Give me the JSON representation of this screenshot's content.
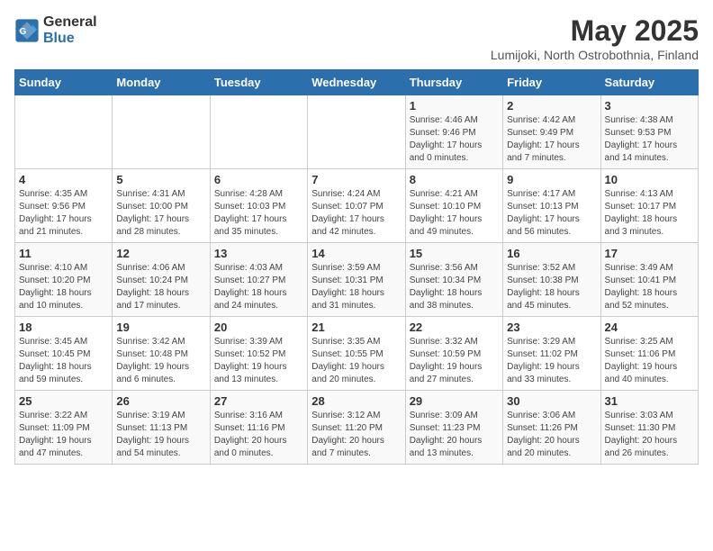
{
  "header": {
    "logo_general": "General",
    "logo_blue": "Blue",
    "title": "May 2025",
    "subtitle": "Lumijoki, North Ostrobothnia, Finland"
  },
  "weekdays": [
    "Sunday",
    "Monday",
    "Tuesday",
    "Wednesday",
    "Thursday",
    "Friday",
    "Saturday"
  ],
  "weeks": [
    [
      {
        "day": "",
        "info": ""
      },
      {
        "day": "",
        "info": ""
      },
      {
        "day": "",
        "info": ""
      },
      {
        "day": "",
        "info": ""
      },
      {
        "day": "1",
        "info": "Sunrise: 4:46 AM\nSunset: 9:46 PM\nDaylight: 17 hours\nand 0 minutes."
      },
      {
        "day": "2",
        "info": "Sunrise: 4:42 AM\nSunset: 9:49 PM\nDaylight: 17 hours\nand 7 minutes."
      },
      {
        "day": "3",
        "info": "Sunrise: 4:38 AM\nSunset: 9:53 PM\nDaylight: 17 hours\nand 14 minutes."
      }
    ],
    [
      {
        "day": "4",
        "info": "Sunrise: 4:35 AM\nSunset: 9:56 PM\nDaylight: 17 hours\nand 21 minutes."
      },
      {
        "day": "5",
        "info": "Sunrise: 4:31 AM\nSunset: 10:00 PM\nDaylight: 17 hours\nand 28 minutes."
      },
      {
        "day": "6",
        "info": "Sunrise: 4:28 AM\nSunset: 10:03 PM\nDaylight: 17 hours\nand 35 minutes."
      },
      {
        "day": "7",
        "info": "Sunrise: 4:24 AM\nSunset: 10:07 PM\nDaylight: 17 hours\nand 42 minutes."
      },
      {
        "day": "8",
        "info": "Sunrise: 4:21 AM\nSunset: 10:10 PM\nDaylight: 17 hours\nand 49 minutes."
      },
      {
        "day": "9",
        "info": "Sunrise: 4:17 AM\nSunset: 10:13 PM\nDaylight: 17 hours\nand 56 minutes."
      },
      {
        "day": "10",
        "info": "Sunrise: 4:13 AM\nSunset: 10:17 PM\nDaylight: 18 hours\nand 3 minutes."
      }
    ],
    [
      {
        "day": "11",
        "info": "Sunrise: 4:10 AM\nSunset: 10:20 PM\nDaylight: 18 hours\nand 10 minutes."
      },
      {
        "day": "12",
        "info": "Sunrise: 4:06 AM\nSunset: 10:24 PM\nDaylight: 18 hours\nand 17 minutes."
      },
      {
        "day": "13",
        "info": "Sunrise: 4:03 AM\nSunset: 10:27 PM\nDaylight: 18 hours\nand 24 minutes."
      },
      {
        "day": "14",
        "info": "Sunrise: 3:59 AM\nSunset: 10:31 PM\nDaylight: 18 hours\nand 31 minutes."
      },
      {
        "day": "15",
        "info": "Sunrise: 3:56 AM\nSunset: 10:34 PM\nDaylight: 18 hours\nand 38 minutes."
      },
      {
        "day": "16",
        "info": "Sunrise: 3:52 AM\nSunset: 10:38 PM\nDaylight: 18 hours\nand 45 minutes."
      },
      {
        "day": "17",
        "info": "Sunrise: 3:49 AM\nSunset: 10:41 PM\nDaylight: 18 hours\nand 52 minutes."
      }
    ],
    [
      {
        "day": "18",
        "info": "Sunrise: 3:45 AM\nSunset: 10:45 PM\nDaylight: 18 hours\nand 59 minutes."
      },
      {
        "day": "19",
        "info": "Sunrise: 3:42 AM\nSunset: 10:48 PM\nDaylight: 19 hours\nand 6 minutes."
      },
      {
        "day": "20",
        "info": "Sunrise: 3:39 AM\nSunset: 10:52 PM\nDaylight: 19 hours\nand 13 minutes."
      },
      {
        "day": "21",
        "info": "Sunrise: 3:35 AM\nSunset: 10:55 PM\nDaylight: 19 hours\nand 20 minutes."
      },
      {
        "day": "22",
        "info": "Sunrise: 3:32 AM\nSunset: 10:59 PM\nDaylight: 19 hours\nand 27 minutes."
      },
      {
        "day": "23",
        "info": "Sunrise: 3:29 AM\nSunset: 11:02 PM\nDaylight: 19 hours\nand 33 minutes."
      },
      {
        "day": "24",
        "info": "Sunrise: 3:25 AM\nSunset: 11:06 PM\nDaylight: 19 hours\nand 40 minutes."
      }
    ],
    [
      {
        "day": "25",
        "info": "Sunrise: 3:22 AM\nSunset: 11:09 PM\nDaylight: 19 hours\nand 47 minutes."
      },
      {
        "day": "26",
        "info": "Sunrise: 3:19 AM\nSunset: 11:13 PM\nDaylight: 19 hours\nand 54 minutes."
      },
      {
        "day": "27",
        "info": "Sunrise: 3:16 AM\nSunset: 11:16 PM\nDaylight: 20 hours\nand 0 minutes."
      },
      {
        "day": "28",
        "info": "Sunrise: 3:12 AM\nSunset: 11:20 PM\nDaylight: 20 hours\nand 7 minutes."
      },
      {
        "day": "29",
        "info": "Sunrise: 3:09 AM\nSunset: 11:23 PM\nDaylight: 20 hours\nand 13 minutes."
      },
      {
        "day": "30",
        "info": "Sunrise: 3:06 AM\nSunset: 11:26 PM\nDaylight: 20 hours\nand 20 minutes."
      },
      {
        "day": "31",
        "info": "Sunrise: 3:03 AM\nSunset: 11:30 PM\nDaylight: 20 hours\nand 26 minutes."
      }
    ]
  ]
}
